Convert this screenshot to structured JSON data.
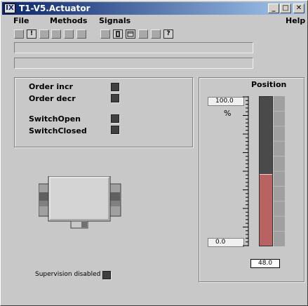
{
  "window": {
    "title": "T1-V5.Actuator",
    "icon_glyph": "IX",
    "minimize_glyph": "_",
    "maximize_glyph": "□",
    "close_glyph": "✕"
  },
  "menu": {
    "file": "File",
    "methods": "Methods",
    "signals": "Signals",
    "help": "Help"
  },
  "toolbar": {
    "info_glyph": "!",
    "help_glyph": "?"
  },
  "signals": {
    "order_incr": "Order incr",
    "order_decr": "Order decr",
    "switch_open": "SwitchOpen",
    "switch_closed": "SwitchClosed"
  },
  "supervision": {
    "label": "Supervision disabled"
  },
  "position": {
    "title": "Position",
    "max": "100.0",
    "min": "0.0",
    "unit": "%",
    "value": "48.0",
    "fill_fraction": 0.48
  },
  "colors": {
    "bar_fill": "#b96262",
    "bar_empty": "#4a4a4a",
    "led_off": "#404040"
  }
}
